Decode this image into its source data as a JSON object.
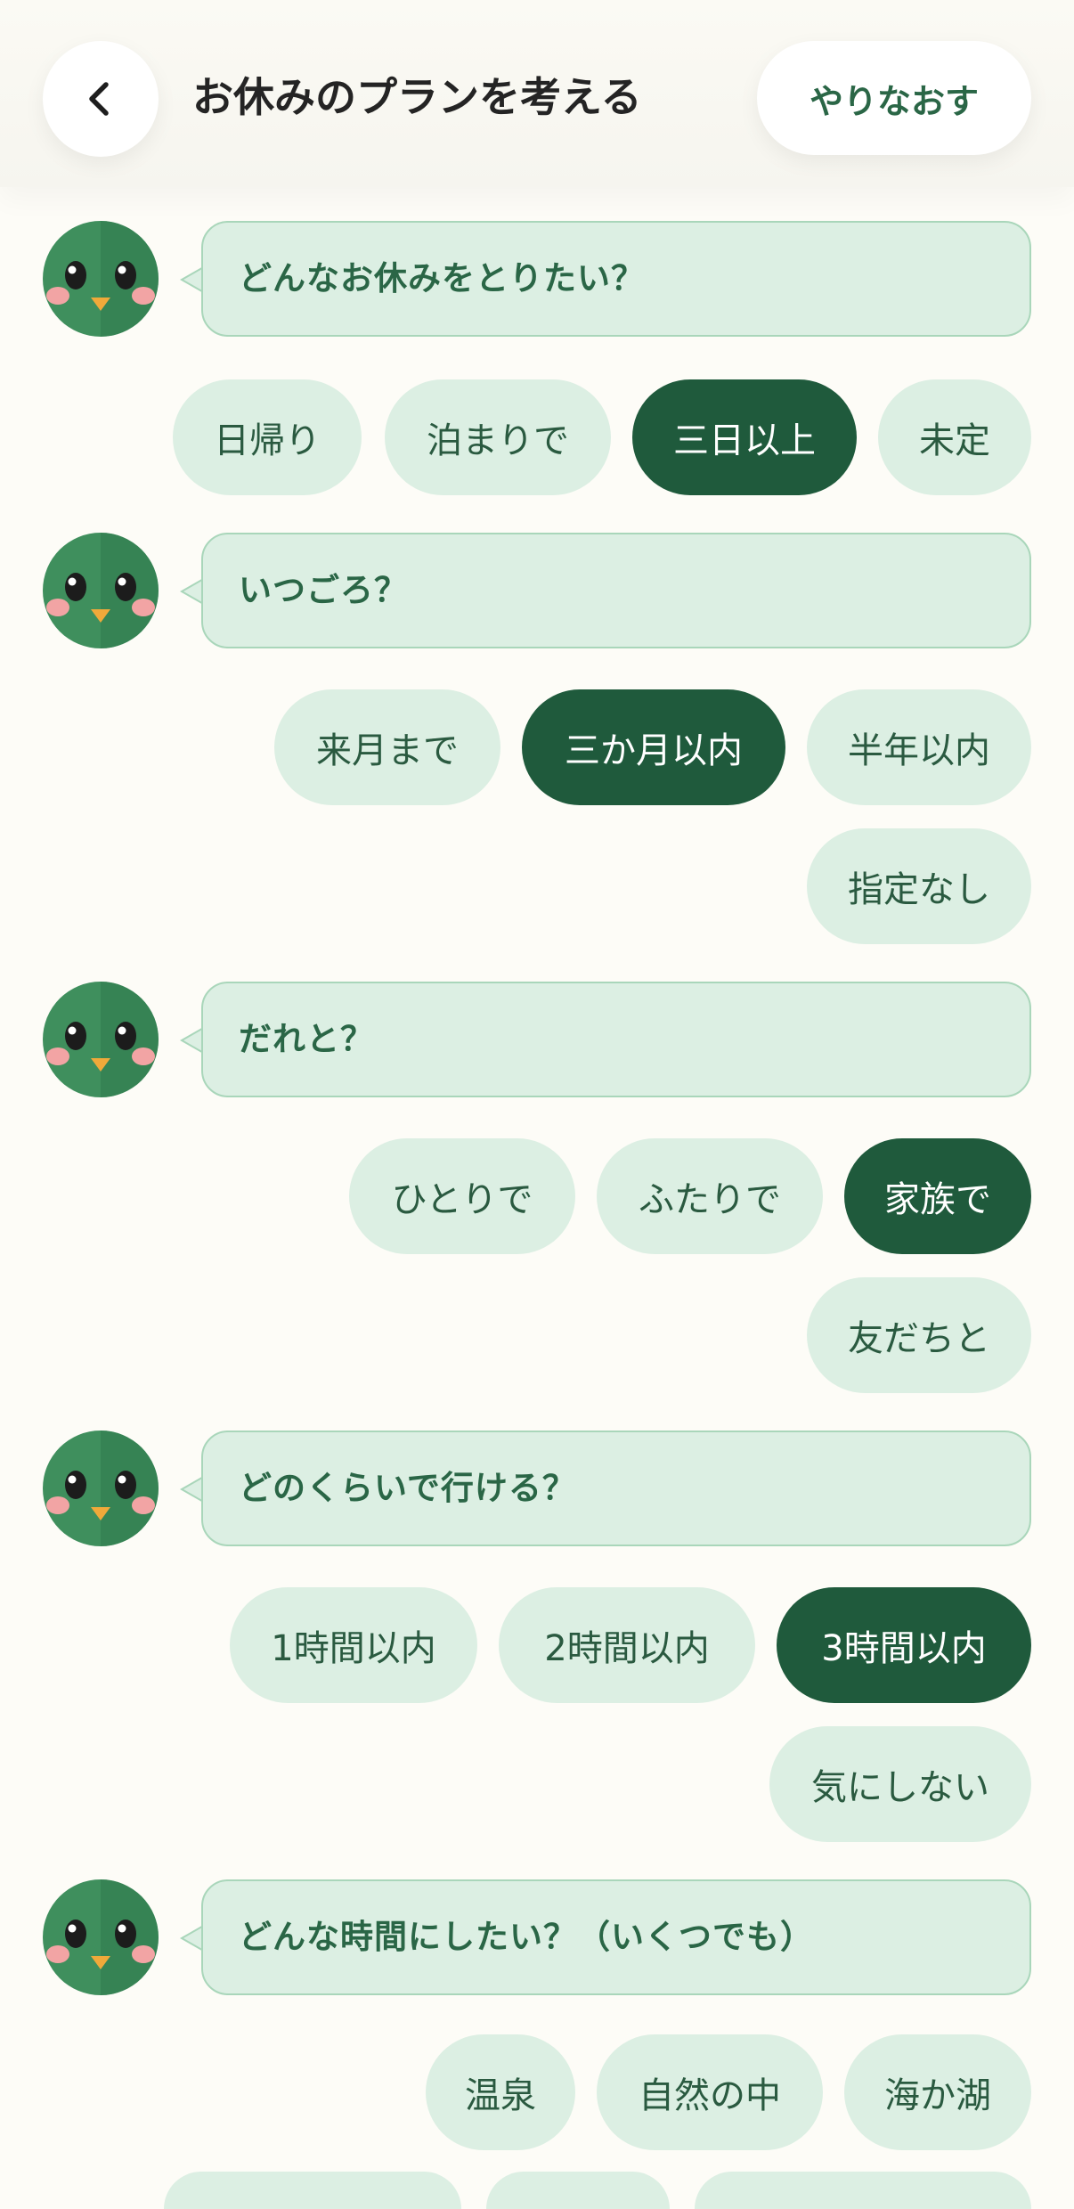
{
  "header": {
    "title": "お休みのプランを考える",
    "redo_label": "やりなおす"
  },
  "icons": {
    "back": "chevron-left-icon",
    "avatar": "bird-mascot-icon"
  },
  "colors": {
    "background": "#fdfcf7",
    "bubble": "#dcefe3",
    "bubble_border": "#a9d6ba",
    "option": "#dcefe3",
    "option_selected": "#1f5a3c",
    "text_green": "#2a6646",
    "mascot_green": "#3f8f5d"
  },
  "questions": [
    {
      "prompt": "どんなお休みをとりたい？",
      "options": [
        {
          "label": "日帰り",
          "selected": false
        },
        {
          "label": "泊まりで",
          "selected": false
        },
        {
          "label": "三日以上",
          "selected": true
        },
        {
          "label": "未定",
          "selected": false
        }
      ]
    },
    {
      "prompt": "いつごろ？",
      "options": [
        {
          "label": "来月まで",
          "selected": false
        },
        {
          "label": "三か月以内",
          "selected": true
        },
        {
          "label": "半年以内",
          "selected": false
        },
        {
          "label": "指定なし",
          "selected": false
        }
      ]
    },
    {
      "prompt": "だれと？",
      "options": [
        {
          "label": "ひとりで",
          "selected": false
        },
        {
          "label": "ふたりで",
          "selected": false
        },
        {
          "label": "家族で",
          "selected": true
        },
        {
          "label": "友だちと",
          "selected": false
        }
      ]
    },
    {
      "prompt": "どのくらいで行ける？",
      "options": [
        {
          "label": "1時間以内",
          "selected": false
        },
        {
          "label": "2時間以内",
          "selected": false
        },
        {
          "label": "3時間以内",
          "selected": true
        },
        {
          "label": "気にしない",
          "selected": false
        }
      ]
    },
    {
      "prompt": "どんな時間にしたい？（いくつでも）",
      "options": [
        {
          "label": "温泉",
          "selected": false
        },
        {
          "label": "自然の中",
          "selected": false
        },
        {
          "label": "海か湖",
          "selected": false
        }
      ]
    }
  ]
}
